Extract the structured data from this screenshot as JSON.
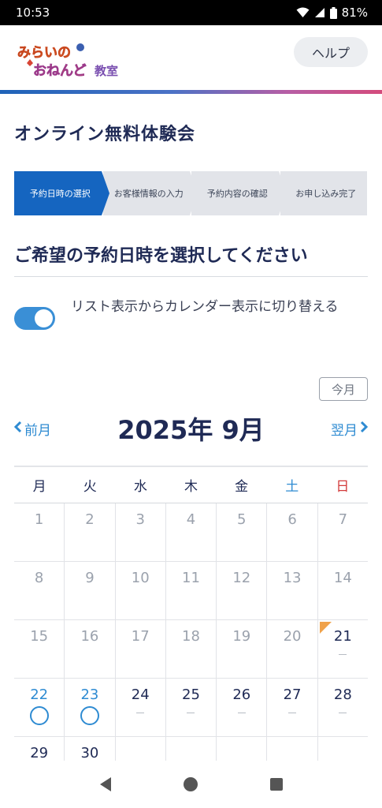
{
  "status_bar": {
    "time": "10:53",
    "battery": "81%"
  },
  "header": {
    "logo_text": "みらいのおねんど教室",
    "help_label": "ヘルプ"
  },
  "page": {
    "title": "オンライン無料体験会"
  },
  "steps": [
    {
      "label": "予約日時の選択",
      "active": true
    },
    {
      "label": "お客様情報の入力",
      "active": false
    },
    {
      "label": "予約内容の確認",
      "active": false
    },
    {
      "label": "お申し込み完了",
      "active": false
    }
  ],
  "subtitle": "ご希望の予約日時を選択してください",
  "toggle": {
    "label": "リスト表示からカレンダー表示に切り替える",
    "on": true
  },
  "calendar": {
    "today_label": "今月",
    "prev_label": "前月",
    "next_label": "翌月",
    "month_title": "2025年 9月",
    "weekdays": [
      "月",
      "火",
      "水",
      "木",
      "金",
      "土",
      "日"
    ],
    "weeks": [
      [
        "1",
        "2",
        "3",
        "4",
        "5",
        "6",
        "7"
      ],
      [
        "8",
        "9",
        "10",
        "11",
        "12",
        "13",
        "14"
      ],
      [
        "15",
        "16",
        "17",
        "18",
        "19",
        "20",
        "21"
      ],
      [
        "22",
        "23",
        "24",
        "25",
        "26",
        "27",
        "28"
      ],
      [
        "29",
        "30",
        "",
        "",
        "",
        "",
        ""
      ]
    ]
  },
  "colors": {
    "primary": "#1565c0",
    "accent": "#2e8bd2",
    "today_marker": "#f0a24a",
    "sunday": "#d33a3a"
  },
  "icons": [
    "wifi-icon",
    "signal-icon",
    "battery-icon",
    "chevron-left-icon",
    "chevron-right-icon",
    "back-icon",
    "home-icon",
    "recents-icon"
  ]
}
